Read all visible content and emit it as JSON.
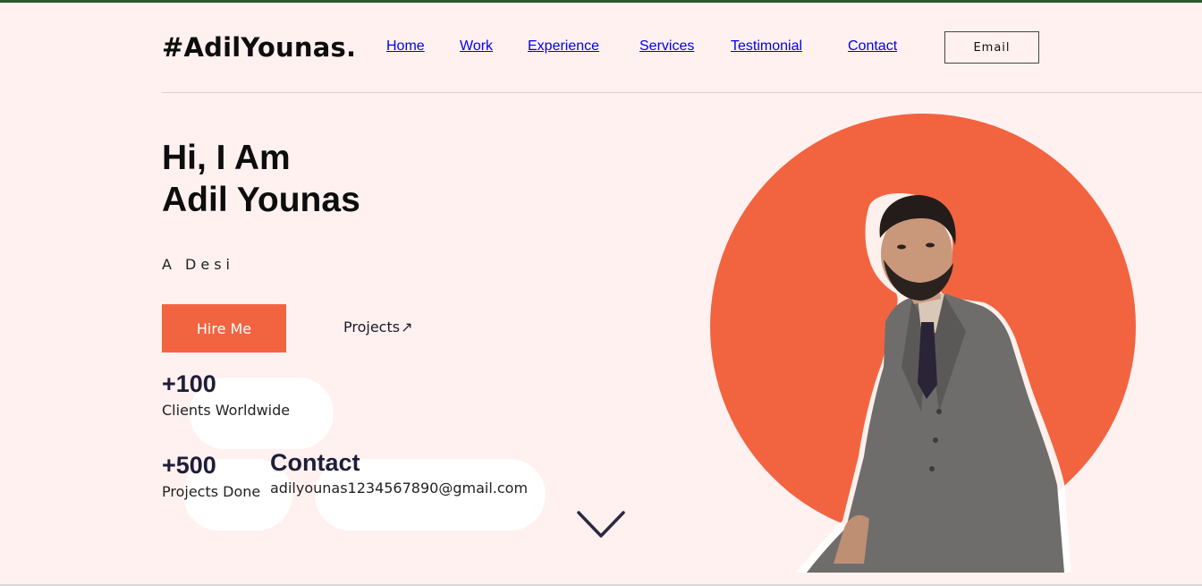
{
  "header": {
    "logo": "#AdilYounas.",
    "nav": [
      "Home",
      "Work",
      "Experience",
      "Services",
      "Testimonial",
      "Contact"
    ],
    "email_button": "Email"
  },
  "hero": {
    "greeting": "Hi, I Am",
    "name": "Adil Younas",
    "tagline": "A Desi",
    "hire_button": "Hire Me",
    "projects_link": "Projects",
    "projects_arrow": "↗"
  },
  "stats": [
    {
      "number": "+100",
      "label": "Clients Worldwide"
    },
    {
      "number": "+500",
      "label": "Projects Done"
    }
  ],
  "contact": {
    "title": "Contact",
    "email": "adilyounas1234567890@gmail.com"
  },
  "icons": {
    "scroll_down": "chevron-down-icon",
    "projects_arrow": "arrow-up-right-icon"
  },
  "colors": {
    "accent": "#f26440",
    "background": "#fff1f0",
    "text_dark": "#1e1e38"
  }
}
